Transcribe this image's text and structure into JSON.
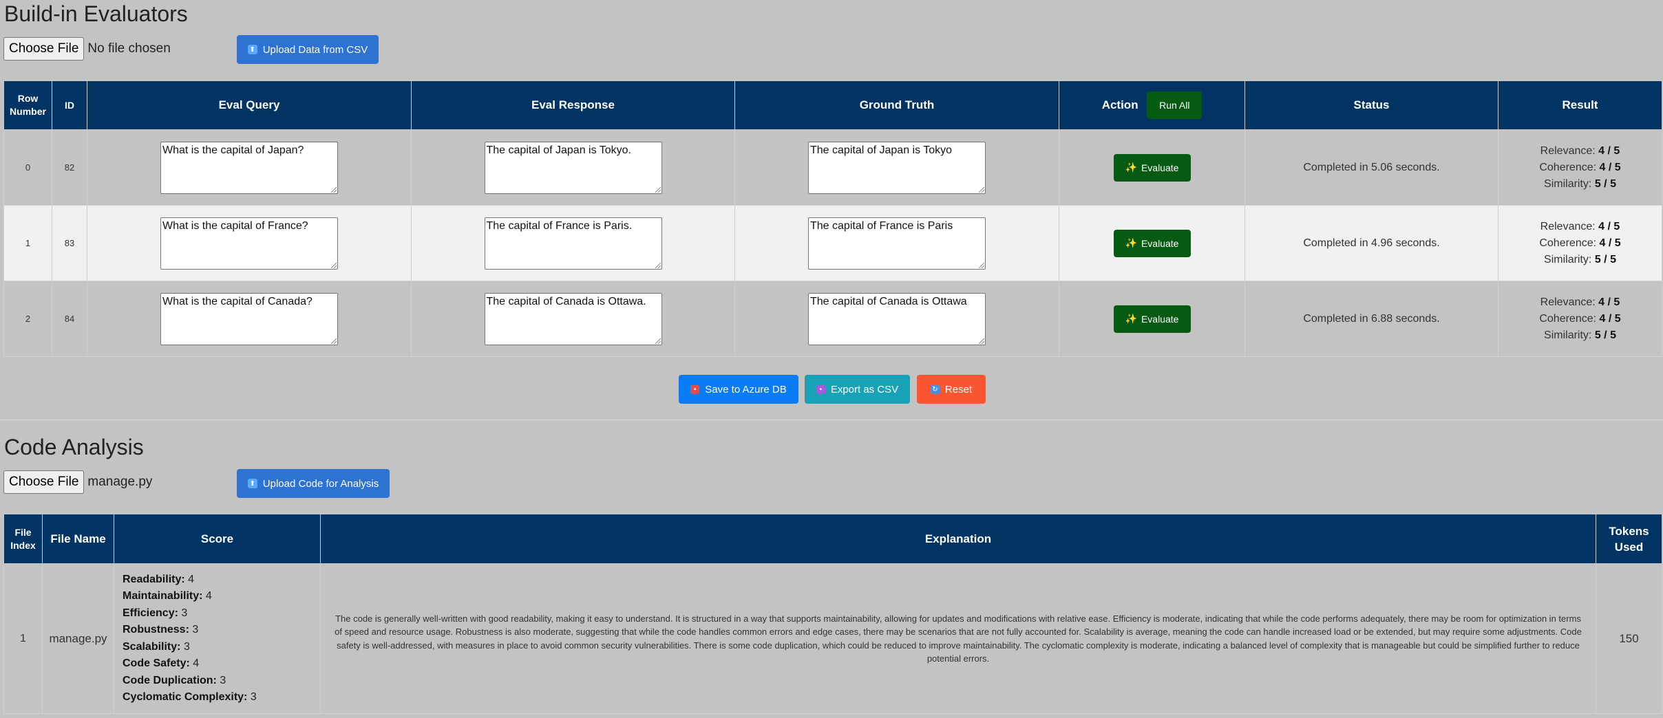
{
  "evaluators": {
    "title": "Build-in Evaluators",
    "choose_file_label": "Choose File",
    "file_status": "No file chosen",
    "upload_label": "Upload Data from CSV",
    "columns": {
      "row_number": "Row Number",
      "id": "ID",
      "eval_query": "Eval Query",
      "eval_response": "Eval Response",
      "ground_truth": "Ground Truth",
      "action": "Action",
      "run_all": "Run All",
      "status": "Status",
      "result": "Result"
    },
    "rows": [
      {
        "row": "0",
        "id": "82",
        "query": "What is the capital of Japan?",
        "response": "The capital of Japan is Tokyo.",
        "truth": "The capital of Japan is Tokyo",
        "button": "Evaluate",
        "status": "Completed in 5.06 seconds.",
        "relevance_label": "Relevance:",
        "relevance": "4 / 5",
        "coherence_label": "Coherence:",
        "coherence": "4 / 5",
        "similarity_label": "Similarity:",
        "similarity": "5 / 5"
      },
      {
        "row": "1",
        "id": "83",
        "query": "What is the capital of France?",
        "response": "The capital of France is Paris.",
        "truth": "The capital of France is Paris",
        "button": "Evaluate",
        "status": "Completed in 4.96 seconds.",
        "relevance_label": "Relevance:",
        "relevance": "4 / 5",
        "coherence_label": "Coherence:",
        "coherence": "4 / 5",
        "similarity_label": "Similarity:",
        "similarity": "5 / 5"
      },
      {
        "row": "2",
        "id": "84",
        "query": "What is the capital of Canada?",
        "response": "The capital of Canada is Ottawa.",
        "truth": "The capital of Canada is Ottawa",
        "button": "Evaluate",
        "status": "Completed in 6.88 seconds.",
        "relevance_label": "Relevance:",
        "relevance": "4 / 5",
        "coherence_label": "Coherence:",
        "coherence": "4 / 5",
        "similarity_label": "Similarity:",
        "similarity": "5 / 5"
      }
    ],
    "actions": {
      "save_label": "Save to Azure DB",
      "export_label": "Export as CSV",
      "reset_label": "Reset"
    }
  },
  "code_analysis": {
    "title": "Code Analysis",
    "choose_file_label": "Choose File",
    "file_status": "manage.py",
    "upload_label": "Upload Code for Analysis",
    "columns": {
      "file_index": "File Index",
      "file_name": "File Name",
      "score": "Score",
      "explanation": "Explanation",
      "tokens": "Tokens Used"
    },
    "row": {
      "index": "1",
      "file_name": "manage.py",
      "scores": [
        {
          "label": "Readability:",
          "value": "4"
        },
        {
          "label": "Maintainability:",
          "value": "4"
        },
        {
          "label": "Efficiency:",
          "value": "3"
        },
        {
          "label": "Robustness:",
          "value": "3"
        },
        {
          "label": "Scalability:",
          "value": "3"
        },
        {
          "label": "Code Safety:",
          "value": "4"
        },
        {
          "label": "Code Duplication:",
          "value": "3"
        },
        {
          "label": "Cyclomatic Complexity:",
          "value": "3"
        }
      ],
      "explanation": "The code is generally well-written with good readability, making it easy to understand. It is structured in a way that supports maintainability, allowing for updates and modifications with relative ease. Efficiency is moderate, indicating that while the code performs adequately, there may be room for optimization in terms of speed and resource usage. Robustness is also moderate, suggesting that while the code handles common errors and edge cases, there may be scenarios that are not fully accounted for. Scalability is average, meaning the code can handle increased load or be extended, but may require some adjustments. Code safety is well-addressed, with measures in place to avoid common security vulnerabilities. There is some code duplication, which could be reduced to improve maintainability. The cyclomatic complexity is moderate, indicating a balanced level of complexity that is manageable but could be simplified further to reduce potential errors.",
      "tokens": "150"
    }
  },
  "colors": {
    "page_bg": "#c3c3c3",
    "header_bg": "#013363",
    "evaluate_green": "#075a12",
    "upload_blue": "#2f73d2",
    "save_blue": "#0a7cf7",
    "export_teal": "#17a2b8",
    "reset_orange": "#fb5632"
  }
}
